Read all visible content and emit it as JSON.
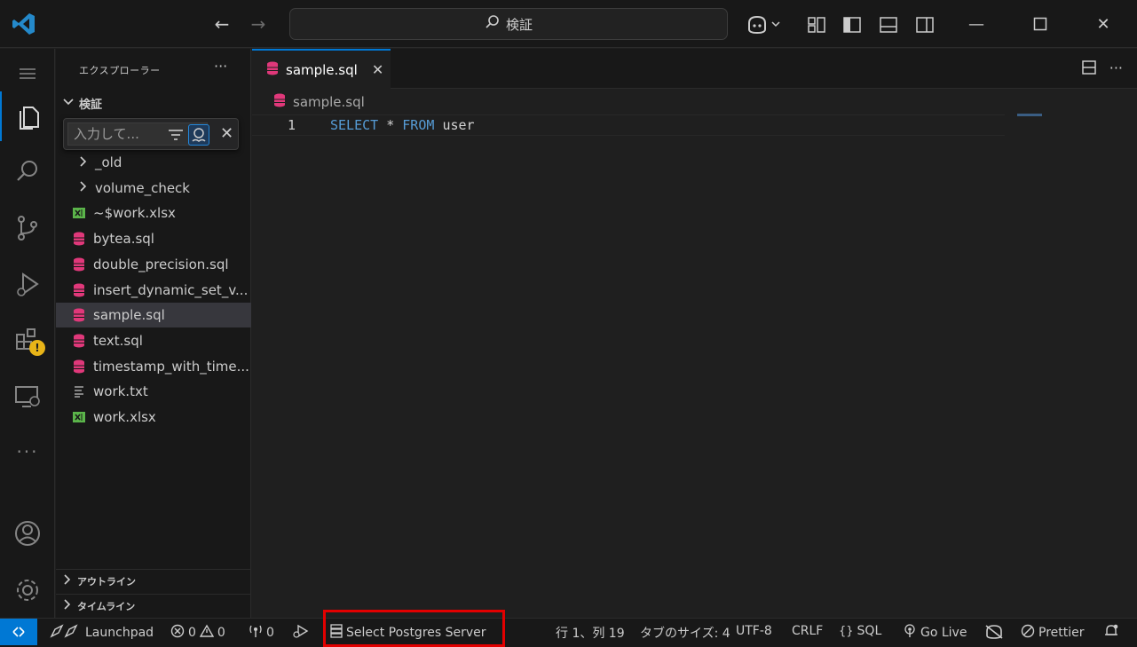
{
  "titlebar": {
    "search_text": "検証"
  },
  "sidebar": {
    "title": "エクスプローラー",
    "more": "···",
    "folder_name": "検証",
    "filter_placeholder": "入力して...",
    "items": [
      {
        "label": "_old",
        "type": "folder"
      },
      {
        "label": "volume_check",
        "type": "folder"
      },
      {
        "label": "~$work.xlsx",
        "type": "excel"
      },
      {
        "label": "bytea.sql",
        "type": "sql"
      },
      {
        "label": "double_precision.sql",
        "type": "sql"
      },
      {
        "label": "insert_dynamic_set_v...",
        "type": "sql"
      },
      {
        "label": "sample.sql",
        "type": "sql",
        "selected": true
      },
      {
        "label": "text.sql",
        "type": "sql"
      },
      {
        "label": "timestamp_with_time...",
        "type": "sql"
      },
      {
        "label": "work.txt",
        "type": "text"
      },
      {
        "label": "work.xlsx",
        "type": "excel"
      }
    ],
    "sections": {
      "outline": "アウトライン",
      "timeline": "タイムライン"
    }
  },
  "editor": {
    "tab_label": "sample.sql",
    "breadcrumb": "sample.sql",
    "line_number": "1",
    "code": {
      "kw1": "SELECT",
      "op": "*",
      "kw2": "FROM",
      "ident": "user"
    }
  },
  "statusbar": {
    "launchpad": "Launchpad",
    "errors": "0",
    "warnings": "0",
    "ports": "0",
    "postgres": "Select Postgres Server",
    "position": "行 1、列 19",
    "tab_size": "タブのサイズ: 4",
    "encoding": "UTF-8",
    "eol": "CRLF",
    "language": "SQL",
    "golive": "Go Live",
    "prettier": "Prettier"
  },
  "colors": {
    "accent": "#0078d4",
    "sql_icon": "#e0387a",
    "excel_icon": "#5bb44a",
    "highlight": "#e30000"
  }
}
